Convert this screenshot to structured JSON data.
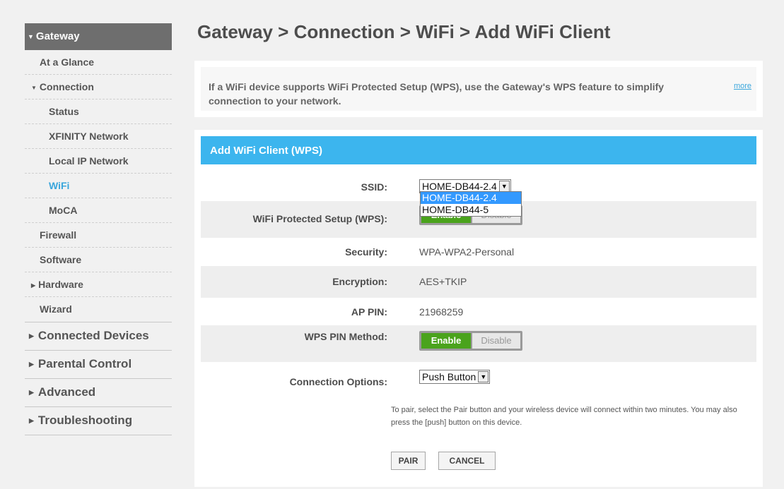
{
  "sidebar": {
    "header": "Gateway",
    "items": [
      {
        "label": "At a Glance",
        "level": 1,
        "active": false
      },
      {
        "label": "Connection",
        "level": 1,
        "expanded": true,
        "active": false
      },
      {
        "label": "Status",
        "level": 2,
        "active": false
      },
      {
        "label": "XFINITY Network",
        "level": 2,
        "active": false
      },
      {
        "label": "Local IP Network",
        "level": 2,
        "active": false
      },
      {
        "label": "WiFi",
        "level": 2,
        "active": true
      },
      {
        "label": "MoCA",
        "level": 2,
        "active": false
      },
      {
        "label": "Firewall",
        "level": 1,
        "active": false
      },
      {
        "label": "Software",
        "level": 1,
        "active": false
      },
      {
        "label": "Hardware",
        "level": 1,
        "expanded": false,
        "active": false
      },
      {
        "label": "Wizard",
        "level": 1,
        "active": false
      }
    ],
    "sections": [
      {
        "label": "Connected Devices"
      },
      {
        "label": "Parental Control"
      },
      {
        "label": "Advanced"
      },
      {
        "label": "Troubleshooting"
      }
    ]
  },
  "page": {
    "title": "Gateway > Connection > WiFi > Add WiFi Client"
  },
  "info": {
    "text": "If a WiFi device supports WiFi Protected Setup (WPS), use the Gateway's WPS feature to simplify connection to your network.",
    "more_link": "more"
  },
  "panel": {
    "header": "Add WiFi Client (WPS)",
    "ssid": {
      "label": "SSID:",
      "selected": "HOME-DB44-2.4",
      "options": [
        "HOME-DB44-2.4",
        "HOME-DB44-5"
      ],
      "highlighted": "HOME-DB44-2.4"
    },
    "wps": {
      "label": "WiFi Protected Setup (WPS):",
      "enable": "Enable",
      "disable": "Disable",
      "value": "Enable"
    },
    "security": {
      "label": "Security:",
      "value": "WPA-WPA2-Personal"
    },
    "encryption": {
      "label": "Encryption:",
      "value": "AES+TKIP"
    },
    "ap_pin": {
      "label": "AP PIN:",
      "value": "21968259"
    },
    "wps_pin_method": {
      "label": "WPS PIN Method:",
      "enable": "Enable",
      "disable": "Disable",
      "value": "Enable"
    },
    "connection_options": {
      "label": "Connection Options:",
      "selected": "Push Button"
    },
    "note": "To pair, select the Pair button and your wireless device will connect within two minutes. You may also press the [push] button on this device.",
    "pair_button": "PAIR",
    "cancel_button": "CANCEL"
  },
  "colors": {
    "accent_blue": "#3cb5ee",
    "active_link": "#3aa6dc",
    "enable_green": "#4aa31c",
    "sidebar_header": "#6e6e6e"
  }
}
